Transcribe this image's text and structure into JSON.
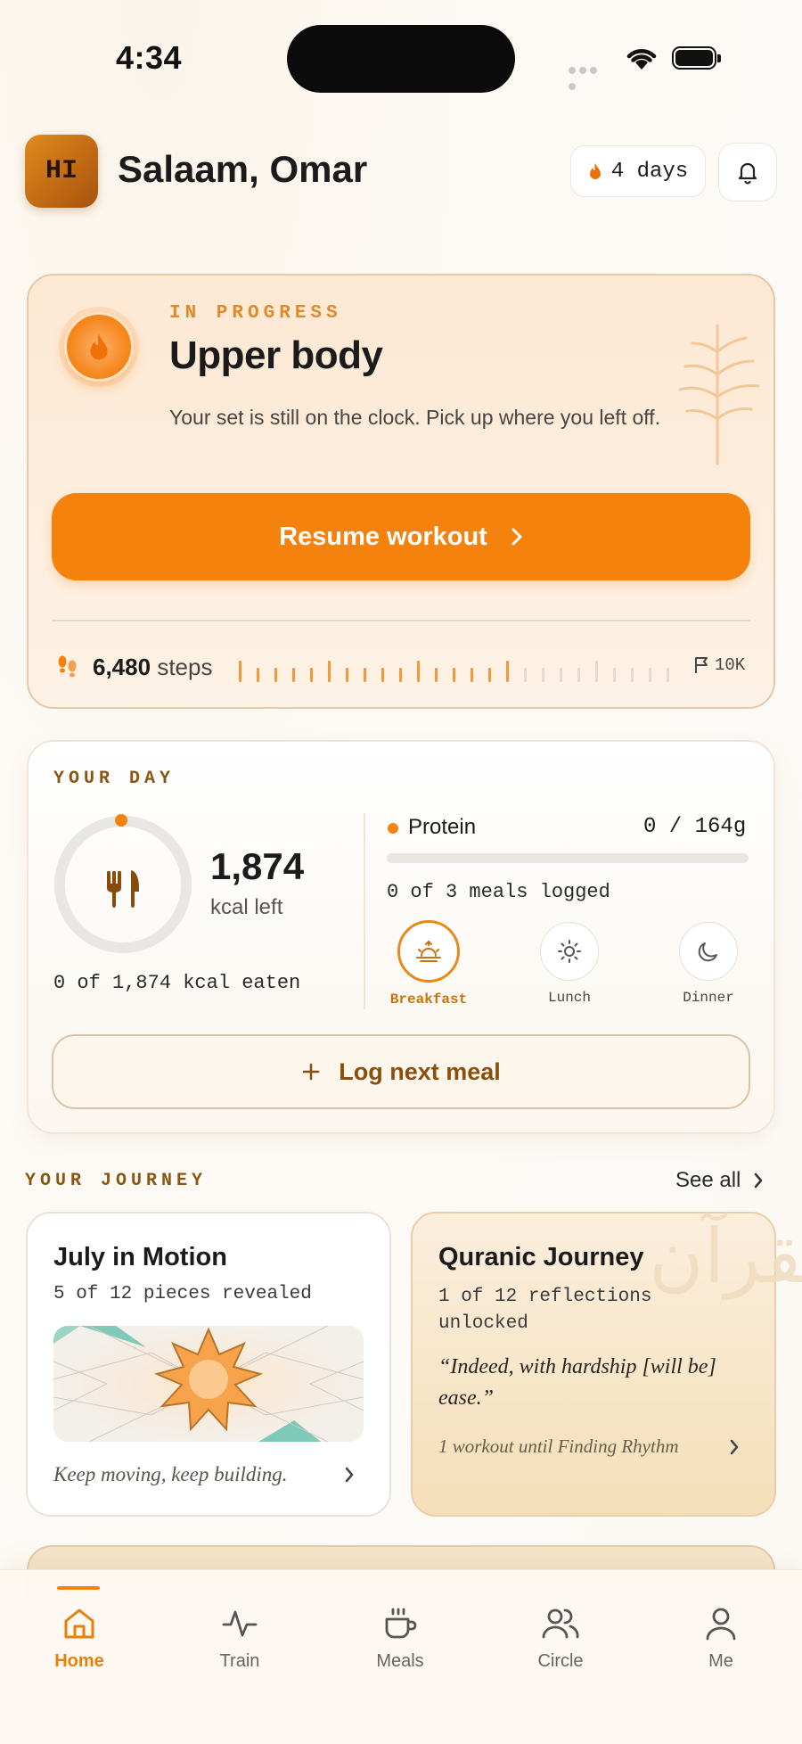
{
  "status_bar": {
    "time": "4:34"
  },
  "header": {
    "avatar_initials": "HI",
    "greeting": "Salaam, Omar",
    "streak_label": "4 days"
  },
  "workout": {
    "status": "IN PROGRESS",
    "title": "Upper body",
    "description": "Your set is still on the clock. Pick up where you left off.",
    "resume_label": "Resume workout",
    "steps_value": "6,480",
    "steps_unit": "steps",
    "steps_goal": "10K",
    "steps_progress": 0.648
  },
  "day": {
    "section_label": "YOUR DAY",
    "kcal_left": "1,874",
    "kcal_left_label": "kcal left",
    "eaten_text": "0 of 1,874 kcal eaten",
    "protein_label": "Protein",
    "protein_value": "0 / 164g",
    "protein_progress": 0,
    "meals_logged": "0 of 3 meals logged",
    "meals": [
      {
        "label": "Breakfast",
        "active": true
      },
      {
        "label": "Lunch",
        "active": false
      },
      {
        "label": "Dinner",
        "active": false
      }
    ],
    "log_button": "Log next meal"
  },
  "journey": {
    "section_label": "YOUR JOURNEY",
    "see_all": "See all",
    "card1": {
      "title": "July in Motion",
      "subtitle": "5 of 12 pieces revealed",
      "caption": "Keep moving, keep building."
    },
    "card2": {
      "title": "Quranic Journey",
      "subtitle": "1 of 12 reflections unlocked",
      "quote": "“Indeed, with hardship [will be] ease.”",
      "footer": "1 workout until Finding Rhythm",
      "watermark": "القرآن"
    }
  },
  "tabs": [
    {
      "label": "Home",
      "icon": "home-icon",
      "active": true
    },
    {
      "label": "Train",
      "icon": "activity-icon",
      "active": false
    },
    {
      "label": "Meals",
      "icon": "cup-icon",
      "active": false
    },
    {
      "label": "Circle",
      "icon": "people-icon",
      "active": false
    },
    {
      "label": "Me",
      "icon": "person-icon",
      "active": false
    }
  ],
  "colors": {
    "accent": "#f5820c",
    "brown": "#8a5510"
  }
}
